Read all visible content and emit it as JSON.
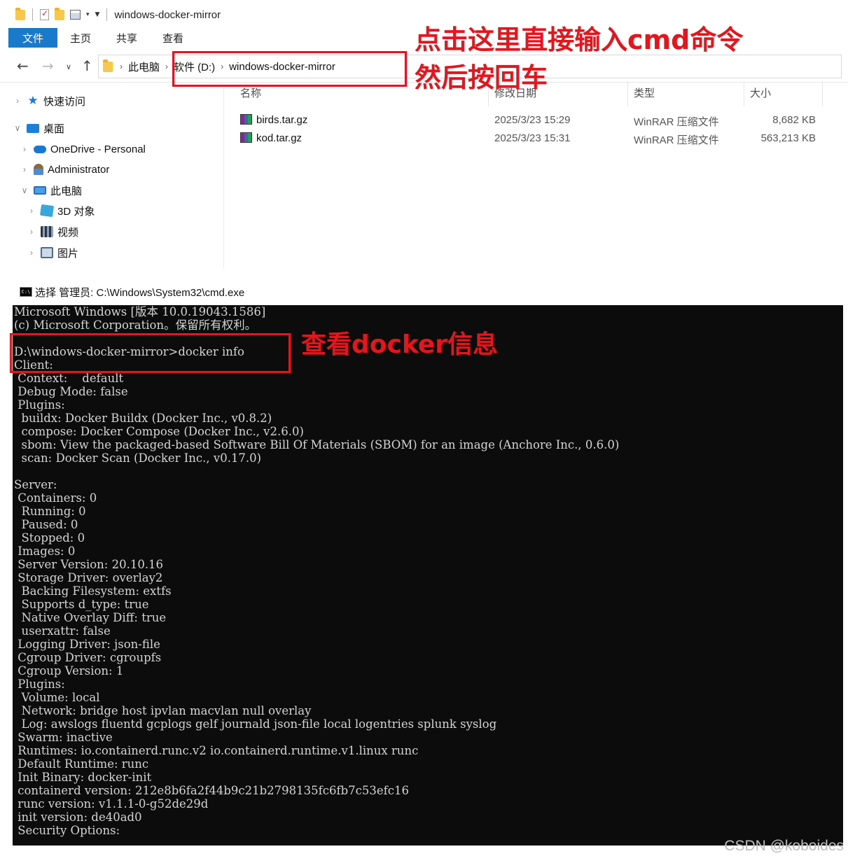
{
  "explorer": {
    "window_title": "windows-docker-mirror",
    "ribbon_tabs": [
      "文件",
      "主页",
      "共享",
      "查看"
    ],
    "breadcrumb": [
      "此电脑",
      "软件 (D:)",
      "windows-docker-mirror"
    ],
    "sidebar": [
      {
        "label": "快速访问",
        "icon": "quick-access-star-icon"
      },
      {
        "label": "桌面",
        "icon": "desktop-icon"
      },
      {
        "label": "OneDrive - Personal",
        "icon": "onedrive-cloud-icon"
      },
      {
        "label": "Administrator",
        "icon": "user-folder-icon"
      },
      {
        "label": "此电脑",
        "icon": "this-pc-icon"
      },
      {
        "label": "3D 对象",
        "icon": "3d-objects-icon"
      },
      {
        "label": "视频",
        "icon": "videos-icon"
      },
      {
        "label": "图片",
        "icon": "pictures-icon"
      }
    ],
    "columns": {
      "name": "名称",
      "modified": "修改日期",
      "type": "类型",
      "size": "大小"
    },
    "files": [
      {
        "name": "birds.tar.gz",
        "modified": "2025/3/23 15:29",
        "type": "WinRAR 压缩文件",
        "size": "8,682 KB"
      },
      {
        "name": "kod.tar.gz",
        "modified": "2025/3/23 15:31",
        "type": "WinRAR 压缩文件",
        "size": "563,213 KB"
      }
    ]
  },
  "annotations": {
    "address_hint_line1": "点击这里直接输入cmd命令",
    "address_hint_line2": "然后按回车",
    "cmd_hint": "查看docker信息",
    "color": "#e8141b"
  },
  "cmd": {
    "title": "选择 管理员: C:\\Windows\\System32\\cmd.exe",
    "lines": [
      "Microsoft Windows [版本 10.0.19043.1586]",
      "(c) Microsoft Corporation。保留所有权利。",
      "",
      "D:\\windows-docker-mirror>docker info",
      "Client:",
      " Context:    default",
      " Debug Mode: false",
      " Plugins:",
      "  buildx: Docker Buildx (Docker Inc., v0.8.2)",
      "  compose: Docker Compose (Docker Inc., v2.6.0)",
      "  sbom: View the packaged-based Software Bill Of Materials (SBOM) for an image (Anchore Inc., 0.6.0)",
      "  scan: Docker Scan (Docker Inc., v0.17.0)",
      "",
      "Server:",
      " Containers: 0",
      "  Running: 0",
      "  Paused: 0",
      "  Stopped: 0",
      " Images: 0",
      " Server Version: 20.10.16",
      " Storage Driver: overlay2",
      "  Backing Filesystem: extfs",
      "  Supports d_type: true",
      "  Native Overlay Diff: true",
      "  userxattr: false",
      " Logging Driver: json-file",
      " Cgroup Driver: cgroupfs",
      " Cgroup Version: 1",
      " Plugins:",
      "  Volume: local",
      "  Network: bridge host ipvlan macvlan null overlay",
      "  Log: awslogs fluentd gcplogs gelf journald json-file local logentries splunk syslog",
      " Swarm: inactive",
      " Runtimes: io.containerd.runc.v2 io.containerd.runtime.v1.linux runc",
      " Default Runtime: runc",
      " Init Binary: docker-init",
      " containerd version: 212e8b6fa2f44b9c21b2798135fc6fb7c53efc16",
      " runc version: v1.1.1-0-g52de29d",
      " init version: de40ad0",
      " Security Options:"
    ]
  },
  "watermark": "CSDN @koboides"
}
